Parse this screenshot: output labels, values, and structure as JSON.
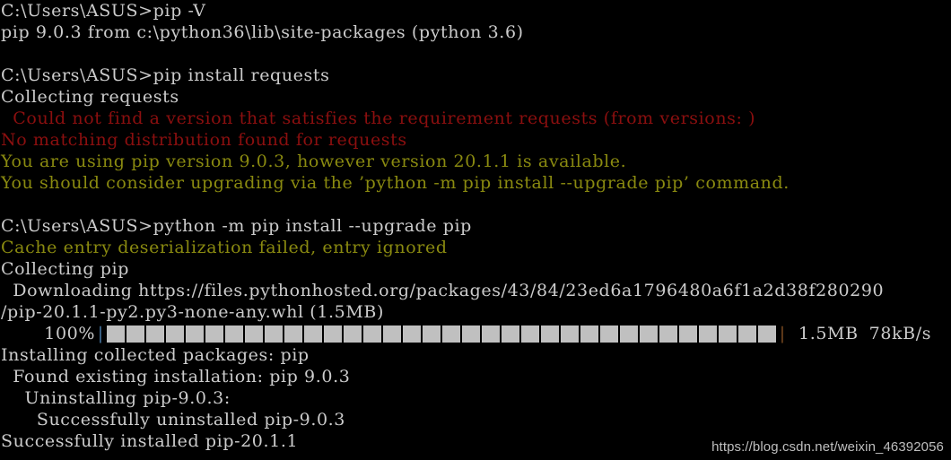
{
  "terminal": {
    "background_color": "#000000",
    "default_text_color": "#cccccc",
    "error_text_color": "#8b0f0f",
    "warning_text_color": "#8a8a10",
    "progress_block_color": "#c0c0c0",
    "lines": [
      {
        "text": "C:\\Users\\ASUS>pip -V",
        "color": "default"
      },
      {
        "text": "pip 9.0.3 from c:\\python36\\lib\\site-packages (python 3.6)",
        "color": "default"
      },
      {
        "text": "",
        "color": "blank"
      },
      {
        "text": "C:\\Users\\ASUS>pip install requests",
        "color": "default"
      },
      {
        "text": "Collecting requests",
        "color": "default"
      },
      {
        "text": "  Could not find a version that satisfies the requirement requests (from versions: )",
        "color": "red"
      },
      {
        "text": "No matching distribution found for requests",
        "color": "red"
      },
      {
        "text": "You are using pip version 9.0.3, however version 20.1.1 is available.",
        "color": "yellow"
      },
      {
        "text": "You should consider upgrading via the ’python -m pip install --upgrade pip’ command.",
        "color": "yellow"
      },
      {
        "text": "",
        "color": "blank"
      },
      {
        "text": "C:\\Users\\ASUS>python -m pip install --upgrade pip",
        "color": "default"
      },
      {
        "text": "Cache entry deserialization failed, entry ignored",
        "color": "yellow"
      },
      {
        "text": "Collecting pip",
        "color": "default"
      },
      {
        "text": "  Downloading https://files.pythonhosted.org/packages/43/84/23ed6a1796480a6f1a2d38f280290",
        "color": "default"
      },
      {
        "text": "/pip-20.1.1-py2.py3-none-any.whl (1.5MB)",
        "color": "default"
      }
    ],
    "progress": {
      "percent_label": "100%",
      "left_delimiter": "|",
      "right_delimiter": "|",
      "block_count": 34,
      "size_label": "1.5MB",
      "speed_label": "78kB/s"
    },
    "lines_after": [
      {
        "text": "Installing collected packages: pip",
        "color": "default"
      },
      {
        "text": "  Found existing installation: pip 9.0.3",
        "color": "default"
      },
      {
        "text": "    Uninstalling pip-9.0.3:",
        "color": "default"
      },
      {
        "text": "      Successfully uninstalled pip-9.0.3",
        "color": "default"
      },
      {
        "text": "Successfully installed pip-20.1.1",
        "color": "default"
      }
    ]
  },
  "watermark": {
    "text": "https://blog.csdn.net/weixin_46392056"
  }
}
